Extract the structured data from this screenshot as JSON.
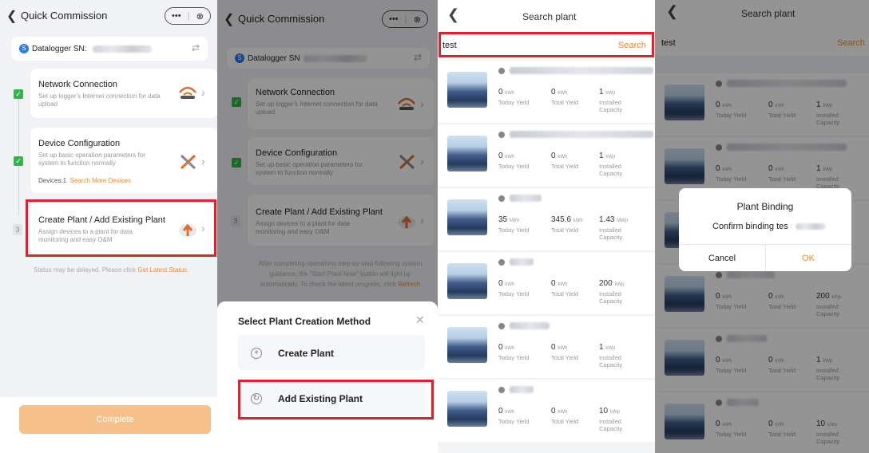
{
  "commission": {
    "title": "Quick Commission",
    "capsule": [
      "•••",
      "⊗"
    ],
    "datalogger_label": "Datalogger SN:",
    "datalogger_label_alt": "Datalogger SN",
    "steps": [
      {
        "title": "Network Connection",
        "subtitle": "Set up logger's Internet connection for data upload"
      },
      {
        "title": "Device Configuration",
        "subtitle": "Set up basic operation parameters for system to function normally"
      },
      {
        "title": "Create Plant / Add Existing Plant",
        "subtitle": "Assign devices to a plant for data monitoring and easy O&M"
      }
    ],
    "devices_prefix": "Devices:1",
    "search_more": "Search More Devices",
    "step_number": "3",
    "status_text": "Status may be delayed. Please click",
    "status_link": "Get Latest Status.",
    "complete": "Complete",
    "guidance_text": "After completing operations step-by-step following system guidance, the \"Start Plant Now\" button will light up automatically. To check the latest progress, click",
    "guidance_link": "Refresh"
  },
  "sheet": {
    "title": "Select Plant Creation Method",
    "options": [
      {
        "label": "Create Plant",
        "icon": "plus-circle-icon"
      },
      {
        "label": "Add Existing Plant",
        "icon": "link-circle-icon"
      }
    ]
  },
  "search": {
    "title": "Search plant",
    "query": "test",
    "button": "Search",
    "labels": {
      "today": "Today Yield",
      "total": "Total Yield",
      "installed_1": "Installed",
      "installed_2": "Capacity"
    },
    "plants": [
      {
        "today": "0",
        "today_unit": "kWh",
        "total": "0",
        "total_unit": "kWh",
        "cap": "1",
        "cap_unit": "kWp"
      },
      {
        "today": "0",
        "today_unit": "kWh",
        "total": "0",
        "total_unit": "kWh",
        "cap": "1",
        "cap_unit": "kWp"
      },
      {
        "today": "35",
        "today_unit": "kWh",
        "total": "345.6",
        "total_unit": "kWh",
        "cap": "1.43",
        "cap_unit": "MWp"
      },
      {
        "today": "0",
        "today_unit": "kWh",
        "total": "0",
        "total_unit": "kWh",
        "cap": "200",
        "cap_unit": "kWp"
      },
      {
        "today": "0",
        "today_unit": "kWh",
        "total": "0",
        "total_unit": "kWh",
        "cap": "1",
        "cap_unit": "kWp"
      },
      {
        "today": "0",
        "today_unit": "kWh",
        "total": "0",
        "total_unit": "kWh",
        "cap": "10",
        "cap_unit": "kWp"
      }
    ]
  },
  "dialog": {
    "title": "Plant Binding",
    "message": "Confirm binding tes",
    "cancel": "Cancel",
    "ok": "OK"
  },
  "colors": {
    "accent": "#f08a24",
    "highlight": "#e0202a",
    "check": "#37b24d",
    "brand_blue": "#2c7be5"
  }
}
